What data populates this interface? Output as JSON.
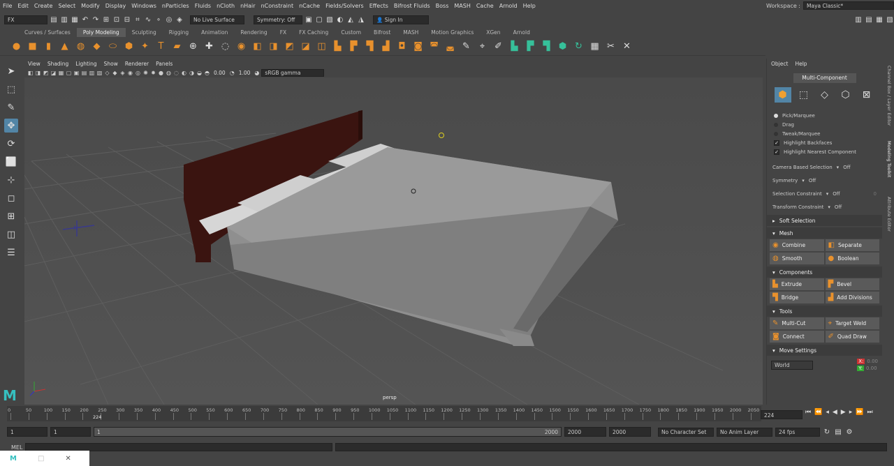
{
  "menubar": [
    "File",
    "Edit",
    "Create",
    "Select",
    "Modify",
    "Display",
    "Windows",
    "nParticles",
    "Fluids",
    "nCloth",
    "nHair",
    "nConstraint",
    "nCache",
    "Fields/Solvers",
    "Effects",
    "Bifrost Fluids",
    "Boss",
    "MASH",
    "Cache",
    "Arnold",
    "Help"
  ],
  "workspace": {
    "label": "Workspace :",
    "value": "Maya Classic*"
  },
  "statusline": {
    "mode": "FX",
    "live_surface": "No Live Surface",
    "symmetry": "Symmetry: Off",
    "sign_in": "Sign In"
  },
  "shelf_tabs": [
    "Curves / Surfaces",
    "Poly Modeling",
    "Sculpting",
    "Rigging",
    "Animation",
    "Rendering",
    "FX",
    "FX Caching",
    "Custom",
    "Bifrost",
    "MASH",
    "Motion Graphics",
    "XGen",
    "Arnold"
  ],
  "shelf_active": "Poly Modeling",
  "panel_menu": [
    "View",
    "Shading",
    "Lighting",
    "Show",
    "Renderer",
    "Panels"
  ],
  "panel_tools": {
    "exposure": "0.00",
    "gamma": "1.00",
    "color_space": "sRGB gamma"
  },
  "viewport": {
    "camera": "persp"
  },
  "right_panel": {
    "menu": [
      "Object",
      "Help"
    ],
    "title": "Multi-Component",
    "modes": [
      "Pick/Marquee",
      "Drag",
      "Tweak/Marquee"
    ],
    "checks": [
      "Highlight Backfaces",
      "Highlight Nearest Component"
    ],
    "camera_based": {
      "label": "Camera Based Selection",
      "value": "Off"
    },
    "symmetry": {
      "label": "Symmetry",
      "value": "Off"
    },
    "selection_constraint": {
      "label": "Selection Constraint",
      "value": "Off",
      "num": "0"
    },
    "transform_constraint": {
      "label": "Transform Constraint",
      "value": "Off"
    },
    "soft_selection": "Soft Selection",
    "mesh": {
      "title": "Mesh",
      "buttons": [
        "Combine",
        "Separate",
        "Smooth",
        "Boolean"
      ]
    },
    "components": {
      "title": "Components",
      "buttons": [
        "Extrude",
        "Bevel",
        "Bridge",
        "Add Divisions"
      ]
    },
    "tools": {
      "title": "Tools",
      "buttons": [
        "Multi-Cut",
        "Target Weld",
        "Connect",
        "Quad Draw"
      ]
    },
    "move_settings": {
      "title": "Move Settings",
      "space": "World",
      "x_label": "X:",
      "x_value": "0.00",
      "y_label": "Y:",
      "y_value": "0.00"
    }
  },
  "side_tabs": [
    "Channel Box / Layer Editor",
    "Modeling Toolkit",
    "Attribute Editor"
  ],
  "timeline": {
    "ticks": [
      "0",
      "50",
      "100",
      "150",
      "200",
      "250",
      "300",
      "350",
      "400",
      "450",
      "500",
      "550",
      "600",
      "650",
      "700",
      "750",
      "800",
      "850",
      "900",
      "950",
      "1000",
      "1050",
      "1100",
      "1150",
      "1200",
      "1250",
      "1300",
      "1350",
      "1400",
      "1450",
      "1500",
      "1550",
      "1600",
      "1650",
      "1700",
      "1750",
      "1800",
      "1850",
      "1900",
      "1950",
      "2000",
      "2050"
    ],
    "current": "224",
    "current_field": "224"
  },
  "range": {
    "start": "1",
    "start2": "1",
    "slider_start": "1",
    "slider_end": "2000",
    "end": "2000",
    "end2": "2000",
    "character_set": "No Character Set",
    "anim_layer": "No Anim Layer",
    "fps": "24 fps"
  },
  "cmdline": {
    "label": "MEL"
  }
}
